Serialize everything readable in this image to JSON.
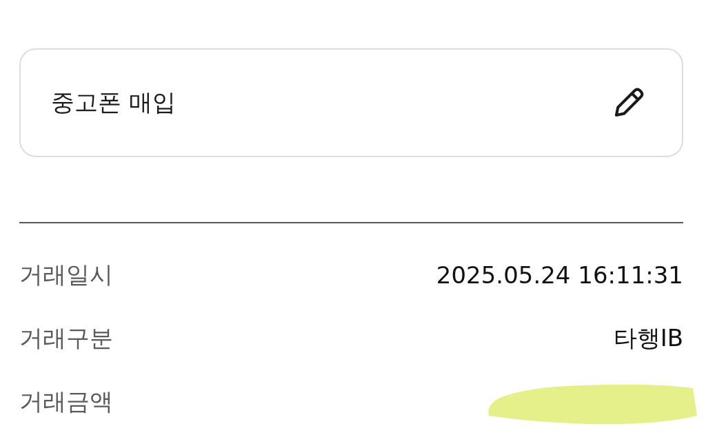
{
  "memo": {
    "text": "중고폰 매입"
  },
  "details": [
    {
      "label": "거래일시",
      "value": "2025.05.24 16:11:31",
      "redacted": false
    },
    {
      "label": "거래구분",
      "value": "타행IB",
      "redacted": false
    },
    {
      "label": "거래금액",
      "redacted": true
    }
  ]
}
